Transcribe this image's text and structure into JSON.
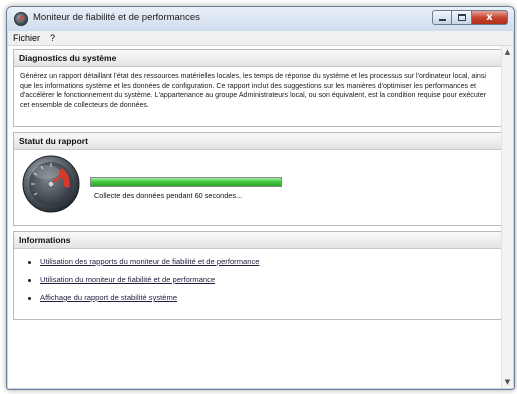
{
  "window": {
    "title": "Moniteur de fiabilité et de performances",
    "buttons": {
      "close_glyph": "x"
    }
  },
  "menu": [
    "Fichier",
    "?"
  ],
  "sections": {
    "diagnostics": {
      "title": "Diagnostics du système",
      "description": "Générez un rapport détaillant l'état des ressources matérielles locales, les temps de réponse du système et les processus sur l'ordinateur local, ainsi que les informations système et les données de configuration. Ce rapport inclut des suggestions sur les manières d'optimiser les performances et d'accélérer le fonctionnement du système. L'appartenance au groupe Administrateurs local, ou son équivalent, est la condition requise pour exécuter cet ensemble de collecteurs de données."
    },
    "report_status": {
      "title": "Statut du rapport",
      "progress": 1.0,
      "status_text": "Collecte des données pendant 60 secondes..."
    },
    "informations": {
      "title": "Informations",
      "links": [
        "Utilisation des rapports du moniteur de fiabilité et de performance",
        "Utilisation du moniteur de fiabilité et de performance",
        "Affichage du rapport de stabilité système"
      ]
    }
  },
  "icons": {
    "app": "gauge-icon",
    "status": "speedometer-icon"
  },
  "colors": {
    "progress": "#3fc63c",
    "close_button": "#c2412b",
    "gauge_needle": "#e03a2a"
  }
}
